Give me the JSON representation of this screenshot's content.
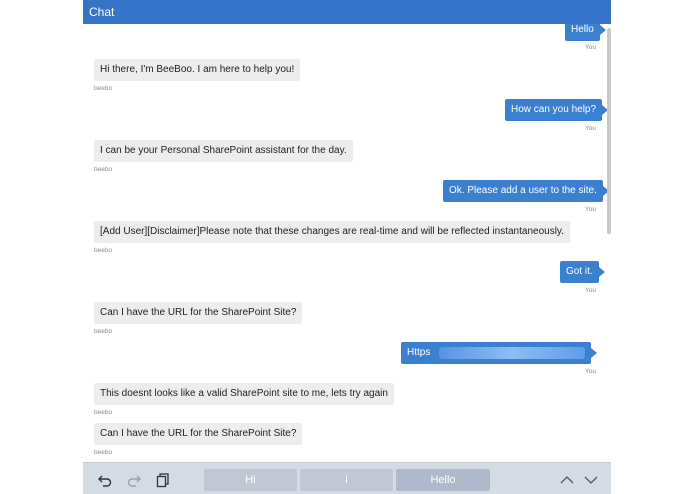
{
  "header": {
    "title": "Chat"
  },
  "messages": [
    {
      "from": "user",
      "text": "Hello",
      "sender": "You"
    },
    {
      "from": "bot",
      "text": "Hi there, I'm BeeBoo. I am here to help you!",
      "sender": "beebo"
    },
    {
      "from": "user",
      "text": "How can you help?",
      "sender": "You"
    },
    {
      "from": "bot",
      "text": "I can be your Personal SharePoint assistant for the day.",
      "sender": "beebo"
    },
    {
      "from": "user",
      "text": "Ok. Please add a user to the site.",
      "sender": "You"
    },
    {
      "from": "bot",
      "text": "[Add User][Disclaimer]Please note that these changes are real-time and will be reflected instantaneously.",
      "sender": "beebo"
    },
    {
      "from": "user",
      "text": "Got it.",
      "sender": "You"
    },
    {
      "from": "bot",
      "text": "Can I have the URL for the SharePoint Site?",
      "sender": "beebo"
    },
    {
      "from": "user",
      "text": "Https",
      "sender": "You"
    },
    {
      "from": "bot",
      "text": "This doesnt looks like a valid SharePoint site to me, lets try again",
      "sender": "beebo"
    },
    {
      "from": "bot",
      "text": "Can I have the URL for the SharePoint Site?",
      "sender": "beebo"
    }
  ],
  "keyboard_bar": {
    "suggestions": [
      "Hi",
      "I",
      "Hello"
    ],
    "icons": [
      "undo-icon",
      "redo-icon",
      "clipboard-icon",
      "chevron-up-icon",
      "chevron-down-icon"
    ]
  },
  "colors": {
    "header": "#3575c9",
    "user_bubble": "#3a7fd0",
    "bot_bubble": "#ededed",
    "toolbar": "#d5dbe4"
  }
}
